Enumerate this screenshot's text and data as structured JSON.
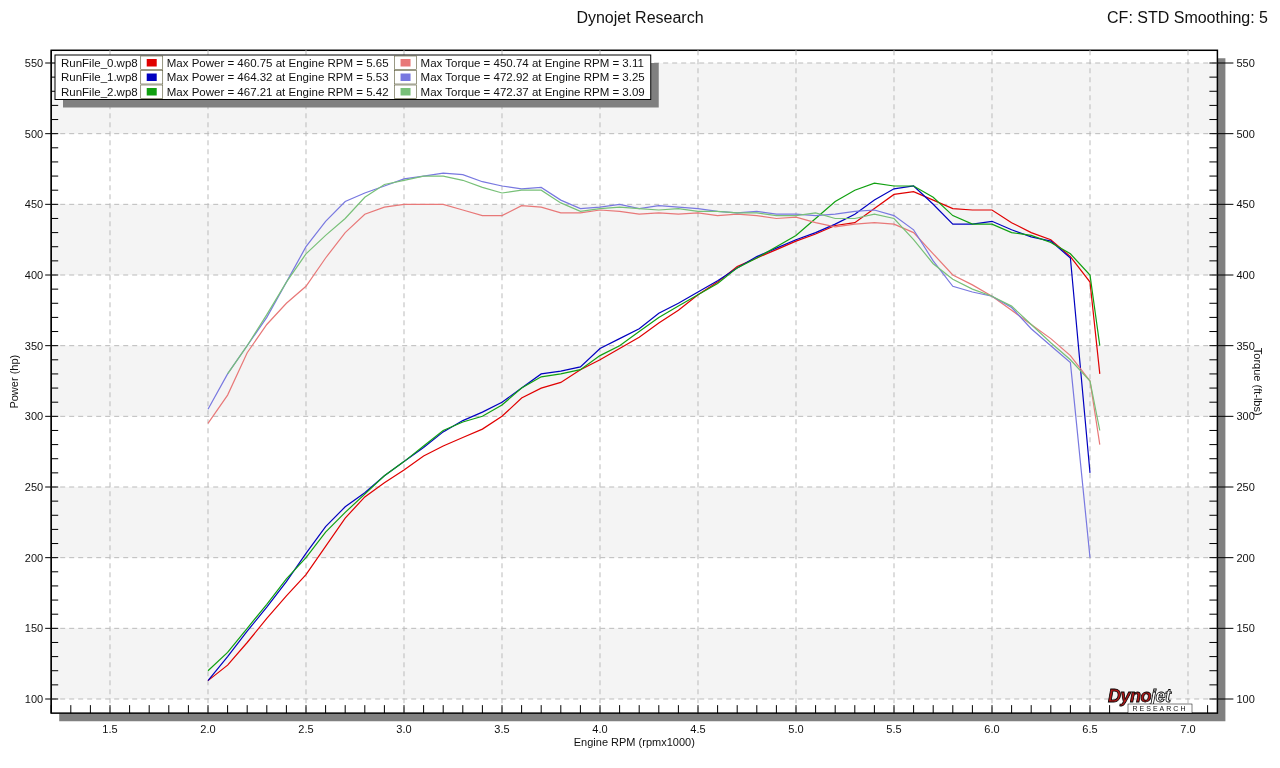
{
  "header": {
    "title": "Dynojet Research",
    "info": "CF: STD Smoothing: 5"
  },
  "chart": {
    "legend": [
      {
        "file": "RunFile_0.wp8",
        "power_text": "Max Power = 460.75 at Engine RPM = 5.65",
        "torque_text": "Max Torque = 450.74 at Engine RPM = 3.11"
      },
      {
        "file": "RunFile_1.wp8",
        "power_text": "Max Power = 464.32 at Engine RPM = 5.53",
        "torque_text": "Max Torque = 472.92 at Engine RPM = 3.25"
      },
      {
        "file": "RunFile_2.wp8",
        "power_text": "Max Power = 467.21 at Engine RPM = 5.42",
        "torque_text": "Max Torque = 472.37 at Engine RPM = 3.09"
      }
    ],
    "right_axis": {
      "label": "Torque (ft-lbs)",
      "ticks": [
        "550",
        "500",
        "450",
        "400",
        "350",
        "300",
        "250",
        "200",
        "150",
        "100"
      ]
    },
    "logo": {
      "parts": [
        "Dyno",
        "jet"
      ],
      "tagline": "RESEARCH"
    },
    "chart_data": {
      "type": "line",
      "xlabel": "Engine RPM (rpmx1000)",
      "ylabel": "Power (hp)",
      "x": [
        2.0,
        2.1,
        2.2,
        2.3,
        2.4,
        2.5,
        2.6,
        2.7,
        2.8,
        2.9,
        3.0,
        3.1,
        3.2,
        3.3,
        3.4,
        3.5,
        3.6,
        3.7,
        3.8,
        3.9,
        4.0,
        4.1,
        4.2,
        4.3,
        4.4,
        4.5,
        4.6,
        4.7,
        4.8,
        4.9,
        5.0,
        5.1,
        5.2,
        5.3,
        5.4,
        5.5,
        5.6,
        5.7,
        5.8,
        5.9,
        6.0,
        6.1,
        6.2,
        6.3,
        6.4,
        6.5,
        6.55
      ],
      "grid": true,
      "xlim": [
        1.2,
        7.15
      ],
      "ylim": [
        90,
        559
      ],
      "xticks": [
        {
          "value": 1.5,
          "label": "1.5"
        },
        {
          "value": 2,
          "label": "2.0"
        },
        {
          "value": 2.5,
          "label": "2.5"
        },
        {
          "value": 3,
          "label": "3.0"
        },
        {
          "value": 3.5,
          "label": "3.5"
        },
        {
          "value": 4,
          "label": "4.0"
        },
        {
          "value": 4.5,
          "label": "4.5"
        },
        {
          "value": 5,
          "label": "5.0"
        },
        {
          "value": 5.5,
          "label": "5.5"
        },
        {
          "value": 6,
          "label": "6.0"
        },
        {
          "value": 6.5,
          "label": "6.5"
        },
        {
          "value": 7,
          "label": "7.0"
        }
      ],
      "yticks": [
        100,
        150,
        200,
        250,
        300,
        350,
        400,
        450,
        500,
        550
      ],
      "series": [
        {
          "color": "#e00000",
          "values": [
            113,
            124,
            140,
            157,
            173,
            188,
            208,
            228,
            243,
            253,
            262,
            272,
            279,
            285,
            291,
            300,
            313,
            320,
            324,
            333,
            340,
            348,
            356,
            366,
            375,
            386,
            395,
            406,
            412,
            418,
            424,
            429,
            435,
            437,
            447,
            457,
            459,
            453,
            447,
            446,
            446,
            437,
            430,
            425,
            413,
            395,
            330
          ]
        },
        {
          "color": "#0000c0",
          "values": [
            113,
            130,
            148,
            165,
            183,
            203,
            222,
            236,
            246,
            258,
            268,
            278,
            289,
            297,
            303,
            310,
            320,
            330,
            332,
            335,
            348,
            355,
            362,
            373,
            380,
            388,
            396,
            405,
            413,
            419,
            425,
            430,
            436,
            443,
            453,
            461,
            463,
            450,
            436,
            436,
            438,
            432,
            427,
            424,
            412,
            260,
            null
          ]
        },
        {
          "color": "#10a010",
          "values": [
            120,
            133,
            150,
            167,
            185,
            200,
            218,
            232,
            245,
            258,
            268,
            279,
            290,
            296,
            300,
            308,
            320,
            328,
            330,
            333,
            343,
            350,
            360,
            370,
            378,
            386,
            394,
            405,
            412,
            420,
            428,
            440,
            452,
            460,
            465,
            463,
            463,
            455,
            442,
            436,
            436,
            430,
            428,
            423,
            415,
            400,
            350
          ]
        },
        {
          "color": "#e87878",
          "values": [
            295,
            315,
            345,
            365,
            380,
            392,
            412,
            430,
            443,
            448,
            450,
            450,
            450,
            446,
            442,
            442,
            449,
            448,
            444,
            444,
            446,
            445,
            443,
            444,
            443,
            444,
            442,
            443,
            442,
            440,
            441,
            437,
            434,
            436,
            437,
            436,
            430,
            415,
            400,
            393,
            385,
            375,
            365,
            355,
            343,
            325,
            280
          ]
        },
        {
          "color": "#7878e0",
          "values": [
            305,
            330,
            350,
            370,
            395,
            420,
            438,
            452,
            458,
            463,
            468,
            470,
            472,
            471,
            466,
            463,
            461,
            462,
            453,
            447,
            448,
            450,
            447,
            449,
            448,
            447,
            445,
            444,
            445,
            443,
            443,
            442,
            443,
            445,
            446,
            442,
            432,
            410,
            392,
            388,
            385,
            377,
            362,
            350,
            338,
            200,
            null
          ]
        },
        {
          "color": "#78c078",
          "values": [
            null,
            330,
            350,
            372,
            395,
            415,
            428,
            440,
            455,
            464,
            467,
            470,
            470,
            467,
            462,
            458,
            460,
            460,
            451,
            445,
            447,
            448,
            447,
            446,
            447,
            445,
            445,
            444,
            444,
            442,
            442,
            444,
            440,
            440,
            443,
            440,
            425,
            408,
            397,
            390,
            385,
            378,
            365,
            352,
            340,
            325,
            290
          ]
        }
      ]
    }
  }
}
